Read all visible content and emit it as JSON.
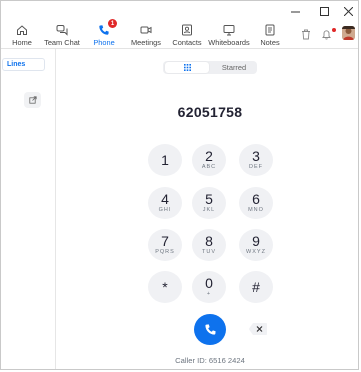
{
  "window": {
    "controls": [
      "minimize",
      "maximize",
      "close"
    ]
  },
  "nav": {
    "items": [
      {
        "label": "Home",
        "icon": "home-icon"
      },
      {
        "label": "Team Chat",
        "icon": "chat-icon"
      },
      {
        "label": "Phone",
        "icon": "phone-icon",
        "badge": "1",
        "active": true
      },
      {
        "label": "Meetings",
        "icon": "video-camera-icon"
      },
      {
        "label": "Contacts",
        "icon": "contacts-icon"
      },
      {
        "label": "Whiteboards",
        "icon": "whiteboard-icon"
      },
      {
        "label": "Notes",
        "icon": "notes-icon"
      }
    ],
    "right_icons": [
      "trash-icon",
      "bell-icon",
      "avatar"
    ]
  },
  "sidebar": {
    "tab_label": "Lines",
    "external_icon": "external-link-icon"
  },
  "segment": {
    "keypad_icon": "keypad-icon",
    "starred_label": "Starred"
  },
  "dialer": {
    "number": "62051758",
    "keys": [
      {
        "digit": "1",
        "letters": ""
      },
      {
        "digit": "2",
        "letters": "ABC"
      },
      {
        "digit": "3",
        "letters": "DEF"
      },
      {
        "digit": "4",
        "letters": "GHI"
      },
      {
        "digit": "5",
        "letters": "JKL"
      },
      {
        "digit": "6",
        "letters": "MNO"
      },
      {
        "digit": "7",
        "letters": "PQRS"
      },
      {
        "digit": "8",
        "letters": "TUV"
      },
      {
        "digit": "9",
        "letters": "WXYZ"
      },
      {
        "digit": "*",
        "letters": ""
      },
      {
        "digit": "0",
        "letters": "+"
      },
      {
        "digit": "#",
        "letters": ""
      }
    ],
    "caller_id": "Caller ID: 6516 2424"
  },
  "colors": {
    "accent": "#0e72ed",
    "badge": "#e02828",
    "key_bg": "#f0f1f4"
  }
}
